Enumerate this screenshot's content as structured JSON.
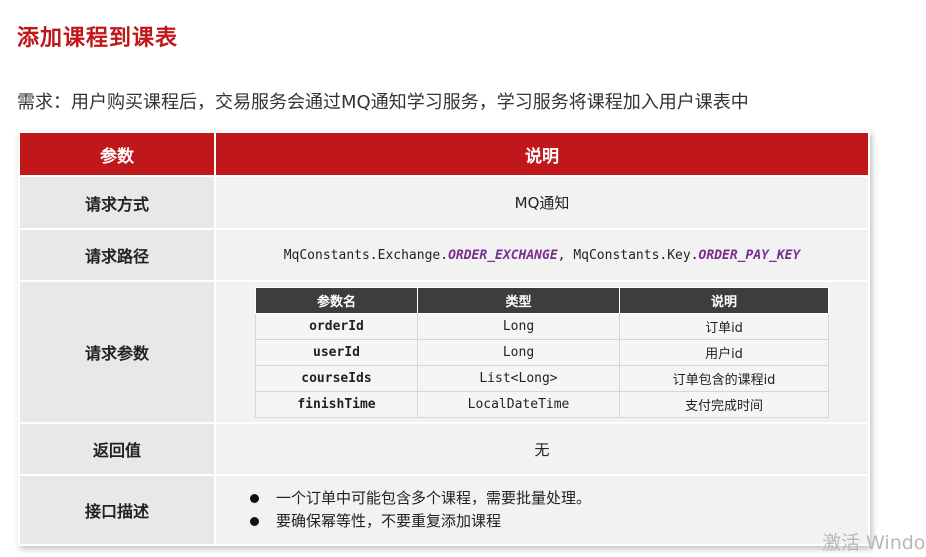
{
  "title": "添加课程到课表",
  "requirement": "需求：用户购买课程后，交易服务会通过MQ通知学习服务，学习服务将课程加入用户课表中",
  "table": {
    "header": {
      "param": "参数",
      "desc": "说明"
    },
    "method": {
      "label": "请求方式",
      "value": "MQ通知"
    },
    "path": {
      "label": "请求路径",
      "part1": "MqConstants.Exchange.",
      "const1": "ORDER_EXCHANGE",
      "sep": ", ",
      "part2": "MqConstants.Key.",
      "const2": "ORDER_PAY_KEY"
    },
    "params": {
      "label": "请求参数",
      "columns": {
        "name": "参数名",
        "type": "类型",
        "desc": "说明"
      },
      "rows": [
        {
          "name": "orderId",
          "type": "Long",
          "desc": "订单id"
        },
        {
          "name": "userId",
          "type": "Long",
          "desc": "用户id"
        },
        {
          "name": "courseIds",
          "type": "List<Long>",
          "desc": "订单包含的课程id"
        },
        {
          "name": "finishTime",
          "type": "LocalDateTime",
          "desc": "支付完成时间"
        }
      ]
    },
    "return": {
      "label": "返回值",
      "value": "无"
    },
    "description": {
      "label": "接口描述",
      "items": [
        "一个订单中可能包含多个课程，需要批量处理。",
        "要确保幂等性，不要重复添加课程"
      ]
    }
  },
  "watermark": "激活 Windo"
}
